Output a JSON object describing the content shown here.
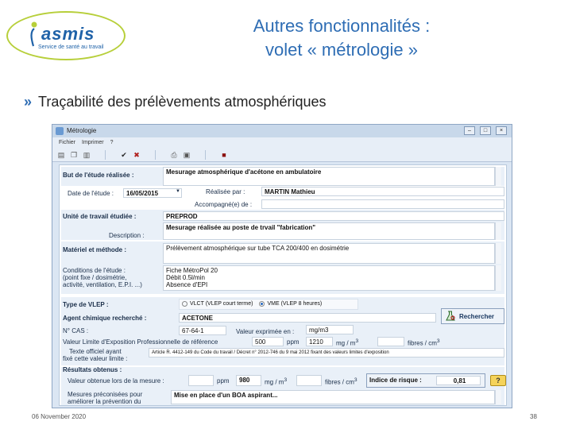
{
  "logo": {
    "name": "asmis",
    "subtitle": "Service de santé au travail"
  },
  "title": {
    "line1": "Autres fonctionnalités :",
    "line2": "volet « métrologie »"
  },
  "bullet": "Traçabilité des prélèvements atmosphériques",
  "window": {
    "title": "Métrologie",
    "menu": [
      "Fichier",
      "Imprimer",
      "?"
    ],
    "controls": [
      "–",
      "□",
      "×"
    ]
  },
  "form": {
    "but_label": "But de l'étude réalisée :",
    "but_value": "Mesurage atmosphérique d'acétone en ambulatoire",
    "date_label": "Date de l'étude :",
    "date_value": "16/05/2015",
    "realise_label": "Réalisée par :",
    "realise_value": "MARTIN Mathieu",
    "accomp_label": "Accompagné(e) de :",
    "accomp_value": "",
    "unite_label": "Unité de travail étudiée :",
    "unite_value": "PREPROD",
    "desc_label": "Description :",
    "desc_value": "Mesurage réalisée au poste de trvail \"fabrication\"",
    "materiel_label": "Matériel et méthode :",
    "materiel_value": "Prélèvement atmosphérique sur tube TCA 200/400 en dosimétrie",
    "conditions_label1": "Conditions de l'étude :",
    "conditions_label2": "(point fixe / dosimétrie,",
    "conditions_label3": "activité, ventilation, E.P.I. ...)",
    "conditions_value1": "Fiche MétroPol 20",
    "conditions_value2": "Débit 0.5l/min",
    "conditions_value3": "Absence d'EPI",
    "type_label": "Type de VLEP :",
    "vlct_label": "VLCT (VLEP court terme)",
    "vme_label": "VME (VLEP 8 heures)",
    "agent_label": "Agent chimique  recherché :",
    "agent_value": "ACETONE",
    "search_button": "Rechercher",
    "cas_label": "N° CAS :",
    "cas_value": "67-64-1",
    "valeur_expr_label": "Valeur exprimée en :",
    "valeur_expr_value": "mg/m3",
    "vlep_label": "Valeur Limite d'Exposition Professionnelle de référence",
    "vlep_ppm": "500",
    "ppm": "ppm",
    "vlep_mg": "1210",
    "mg_m3": "mg / m",
    "fibres_cm3": "fibres / cm",
    "texte_label1": "Texte officiel ayant",
    "texte_label2": "fixé cette valeur limite :",
    "texte_value": "Article R. 4412-149 du Code du travail / Décret n° 2012-746 du 9 mai 2012 fixant des valeurs limites d'exposition",
    "resultats_label": "Résultats  obtenus :",
    "valeur_obtenue_label": "Valeur obtenue lors de la mesure :",
    "res_ppm": "",
    "res_mg": "980",
    "res_fibres": "",
    "indice_label": "Indice de risque :",
    "indice_value": "0,81",
    "help": "?",
    "mesures_label1": "Mesures préconisées pour",
    "mesures_label2": "améliorer la prévention du",
    "mesures_value": "Mise en place d'un BOA aspirant..."
  },
  "footer": {
    "date": "06 November 2020",
    "page": "38"
  }
}
